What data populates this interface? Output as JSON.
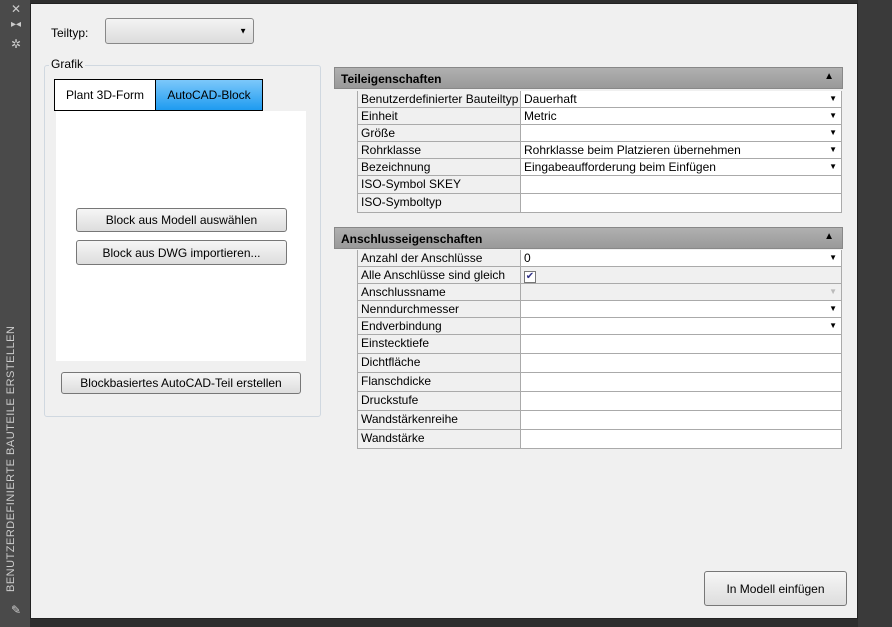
{
  "sidebar": {
    "title": "BENUTZERDEFINIERTE BAUTEILE ERSTELLEN"
  },
  "teiltyp": {
    "label": "Teiltyp:",
    "value": ""
  },
  "grafik": {
    "label": "Grafik",
    "tabs": [
      "Plant 3D-Form",
      "AutoCAD-Block"
    ],
    "active_tab": "AutoCAD-Block",
    "select_block": "Block aus Modell auswählen",
    "import_block": "Block aus DWG importieren...",
    "create": "Blockbasiertes AutoCAD-Teil erstellen"
  },
  "teil": {
    "title": "Teileigenschaften",
    "rows": [
      {
        "k": "Benutzerdefinierter Bauteiltyp",
        "v": "Dauerhaft",
        "dd": true
      },
      {
        "k": "Einheit",
        "v": "Metric",
        "dd": true
      },
      {
        "k": "Größe",
        "v": "",
        "dd": true
      },
      {
        "k": "Rohrklasse",
        "v": " Rohrklasse beim Platzieren übernehmen",
        "dd": true
      },
      {
        "k": "Bezeichnung",
        "v": "Eingabeaufforderung beim Einfügen",
        "dd": true
      },
      {
        "k": "ISO-Symbol SKEY",
        "v": "",
        "dd": false
      },
      {
        "k": "ISO-Symboltyp",
        "v": "",
        "dd": false
      }
    ]
  },
  "anschluss": {
    "title": "Anschlusseigenschaften",
    "rows": [
      {
        "k": "Anzahl der Anschlüsse",
        "v": "0",
        "dd": true
      },
      {
        "k": "Alle Anschlüsse sind gleich",
        "checked": true
      },
      {
        "k": "Anschlussname",
        "v": "",
        "dd": true,
        "disabled": true
      },
      {
        "k": "Nenndurchmesser",
        "v": "",
        "dd": true
      },
      {
        "k": "Endverbindung",
        "v": "",
        "dd": true
      },
      {
        "k": "Einstecktiefe",
        "v": ""
      },
      {
        "k": "Dichtfläche",
        "v": ""
      },
      {
        "k": "Flanschdicke",
        "v": ""
      },
      {
        "k": "Druckstufe",
        "v": ""
      },
      {
        "k": "Wandstärkenreihe",
        "v": ""
      },
      {
        "k": "Wandstärke",
        "v": ""
      }
    ]
  },
  "insert_button": "In Modell einfügen",
  "colors": {
    "active_tab": "#1e9bf0",
    "header": "#a8a8a8"
  }
}
